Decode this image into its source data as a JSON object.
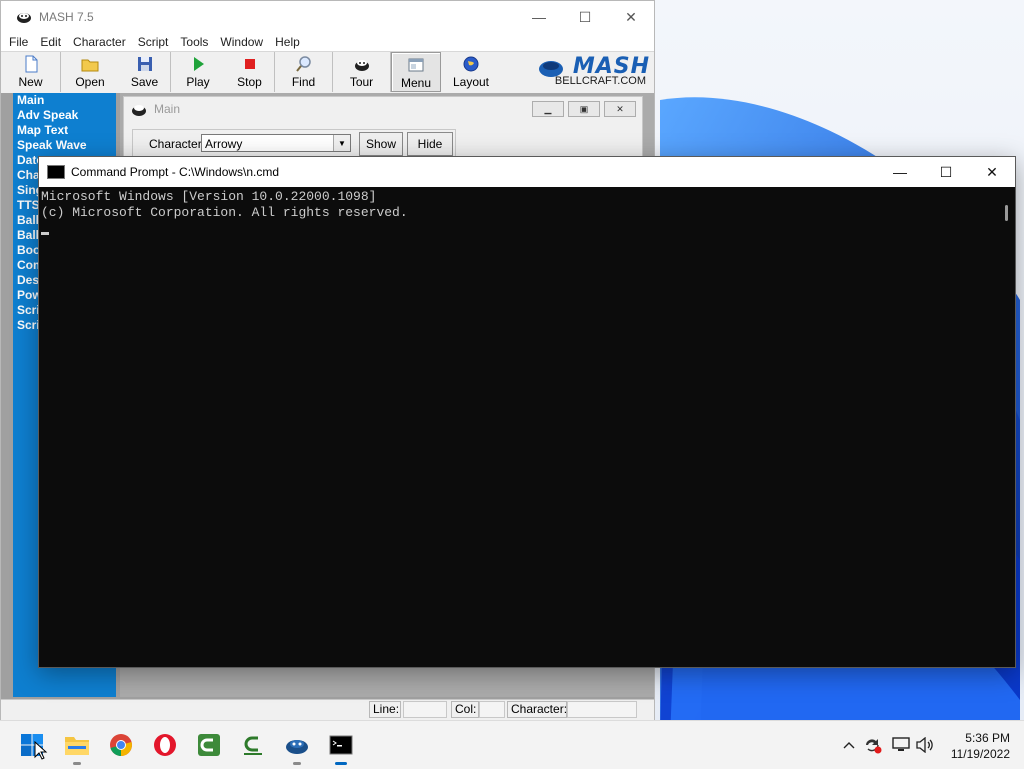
{
  "mash": {
    "title": "MASH 7.5",
    "menus": [
      "File",
      "Edit",
      "Character",
      "Script",
      "Tools",
      "Window",
      "Help"
    ],
    "toolbar": {
      "new": "New",
      "open": "Open",
      "save": "Save",
      "play": "Play",
      "stop": "Stop",
      "find": "Find",
      "tour": "Tour",
      "menu": "Menu",
      "layout": "Layout"
    },
    "brand": {
      "logo_text": "MASH",
      "site": "BELLCRAFT.COM"
    },
    "sidebar_items": [
      "Main",
      "Adv Speak",
      "Map Text",
      "Speak Wave",
      "Date",
      "Cha",
      "Sing",
      "TTS",
      "Ball",
      "Ball",
      "Boo",
      "Com",
      "Des",
      "Pow",
      "Scri",
      "Scri"
    ],
    "child_window": {
      "title": "Main",
      "character_label": "Character",
      "character_value": "Arrowy",
      "show_label": "Show",
      "hide_label": "Hide"
    },
    "status": {
      "line_label": "Line:",
      "col_label": "Col:",
      "character_label": "Character:"
    }
  },
  "cmd": {
    "title": "Command Prompt - C:\\Windows\\n.cmd",
    "lines": [
      "Microsoft Windows [Version 10.0.22000.1098]",
      "(c) Microsoft Corporation. All rights reserved."
    ]
  },
  "taskbar": {
    "clock_time": "5:36 PM",
    "clock_date": "11/19/2022"
  },
  "colors": {
    "sidebar": "#0e7fd0",
    "console_bg": "#0c0c0c",
    "console_text": "#cccccc",
    "accent": "#0067c0"
  }
}
